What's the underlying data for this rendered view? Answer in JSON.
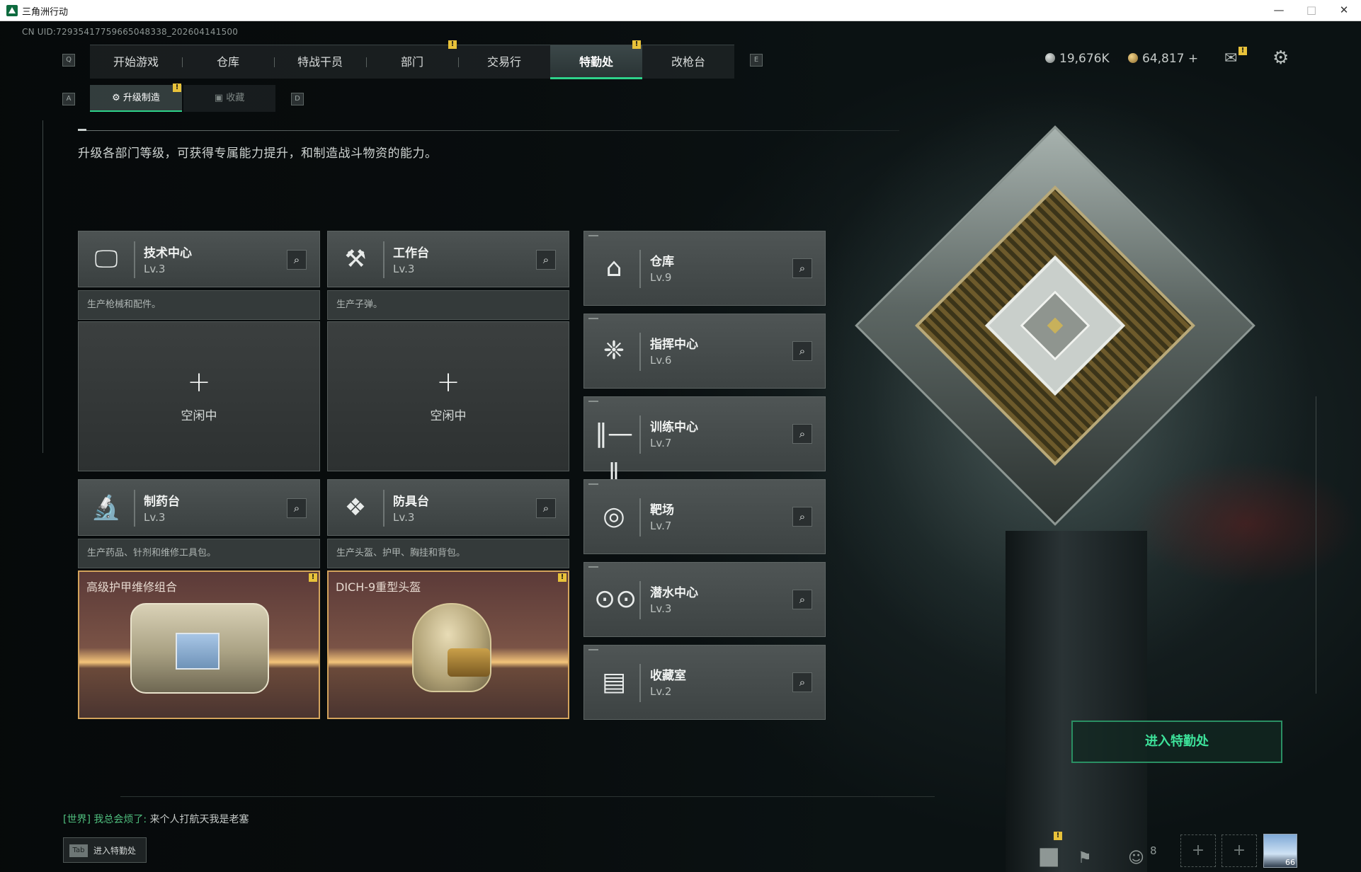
{
  "window": {
    "title": "三角洲行动"
  },
  "header": {
    "uid": "CN UID:7293541775966504833​8_202604141500",
    "key_left": "Q",
    "key_right": "E",
    "tabs": [
      {
        "label": "开始游戏"
      },
      {
        "label": "仓库"
      },
      {
        "label": "特战干员"
      },
      {
        "label": "部门"
      },
      {
        "label": "交易行"
      },
      {
        "label": "特勤处"
      },
      {
        "label": "改枪台"
      }
    ],
    "active_tab": "特勤处",
    "currency_silver": "19,676K",
    "currency_gold": "64,817 +",
    "alert": "!"
  },
  "subtabs": {
    "key_left": "A",
    "key_right": "D",
    "items": [
      {
        "label": "升级制造"
      },
      {
        "label": "收藏"
      }
    ]
  },
  "intro": "升级各部门等级，可获得专属能力提升，和制造战斗物资的能力。",
  "workbenches": [
    {
      "name": "技术中心",
      "level": "Lv.3",
      "desc": "生产枪械和配件。",
      "state": "空闲中",
      "icon": "monitor-icon"
    },
    {
      "name": "工作台",
      "level": "Lv.3",
      "desc": "生产子弹。",
      "state": "空闲中",
      "icon": "tools-icon"
    },
    {
      "name": "制药台",
      "level": "Lv.3",
      "desc": "生产药品、针剂和维修工具包。",
      "item": "高级护甲维修组合",
      "icon": "microscope-icon"
    },
    {
      "name": "防具台",
      "level": "Lv.3",
      "desc": "生产头盔、护甲、胸挂和背包。",
      "item": "DICH-9重型头盔",
      "icon": "blocks-icon"
    }
  ],
  "facilities": [
    {
      "name": "仓库",
      "level": "Lv.9",
      "icon": "warehouse-icon"
    },
    {
      "name": "指挥中心",
      "level": "Lv.6",
      "icon": "command-icon"
    },
    {
      "name": "训练中心",
      "level": "Lv.7",
      "icon": "dumbbell-icon"
    },
    {
      "name": "靶场",
      "level": "Lv.7",
      "icon": "target-icon"
    },
    {
      "name": "潜水中心",
      "level": "Lv.3",
      "icon": "diving-mask-icon"
    },
    {
      "name": "收藏室",
      "level": "Lv.2",
      "icon": "collection-icon"
    }
  ],
  "enter_button": "进入特勤处",
  "chat": {
    "channel": "[世界]",
    "user": "我总会烦了:",
    "message": "来个人打航天我是老塞"
  },
  "tab_hint": {
    "key": "Tab",
    "label": "进入特勤处"
  },
  "bottom_bar": {
    "friends_count": "8",
    "avatar_level": "66"
  },
  "colors": {
    "accent": "#2ed28a",
    "badge": "#e8c23a",
    "item_border": "#d3a35c"
  }
}
